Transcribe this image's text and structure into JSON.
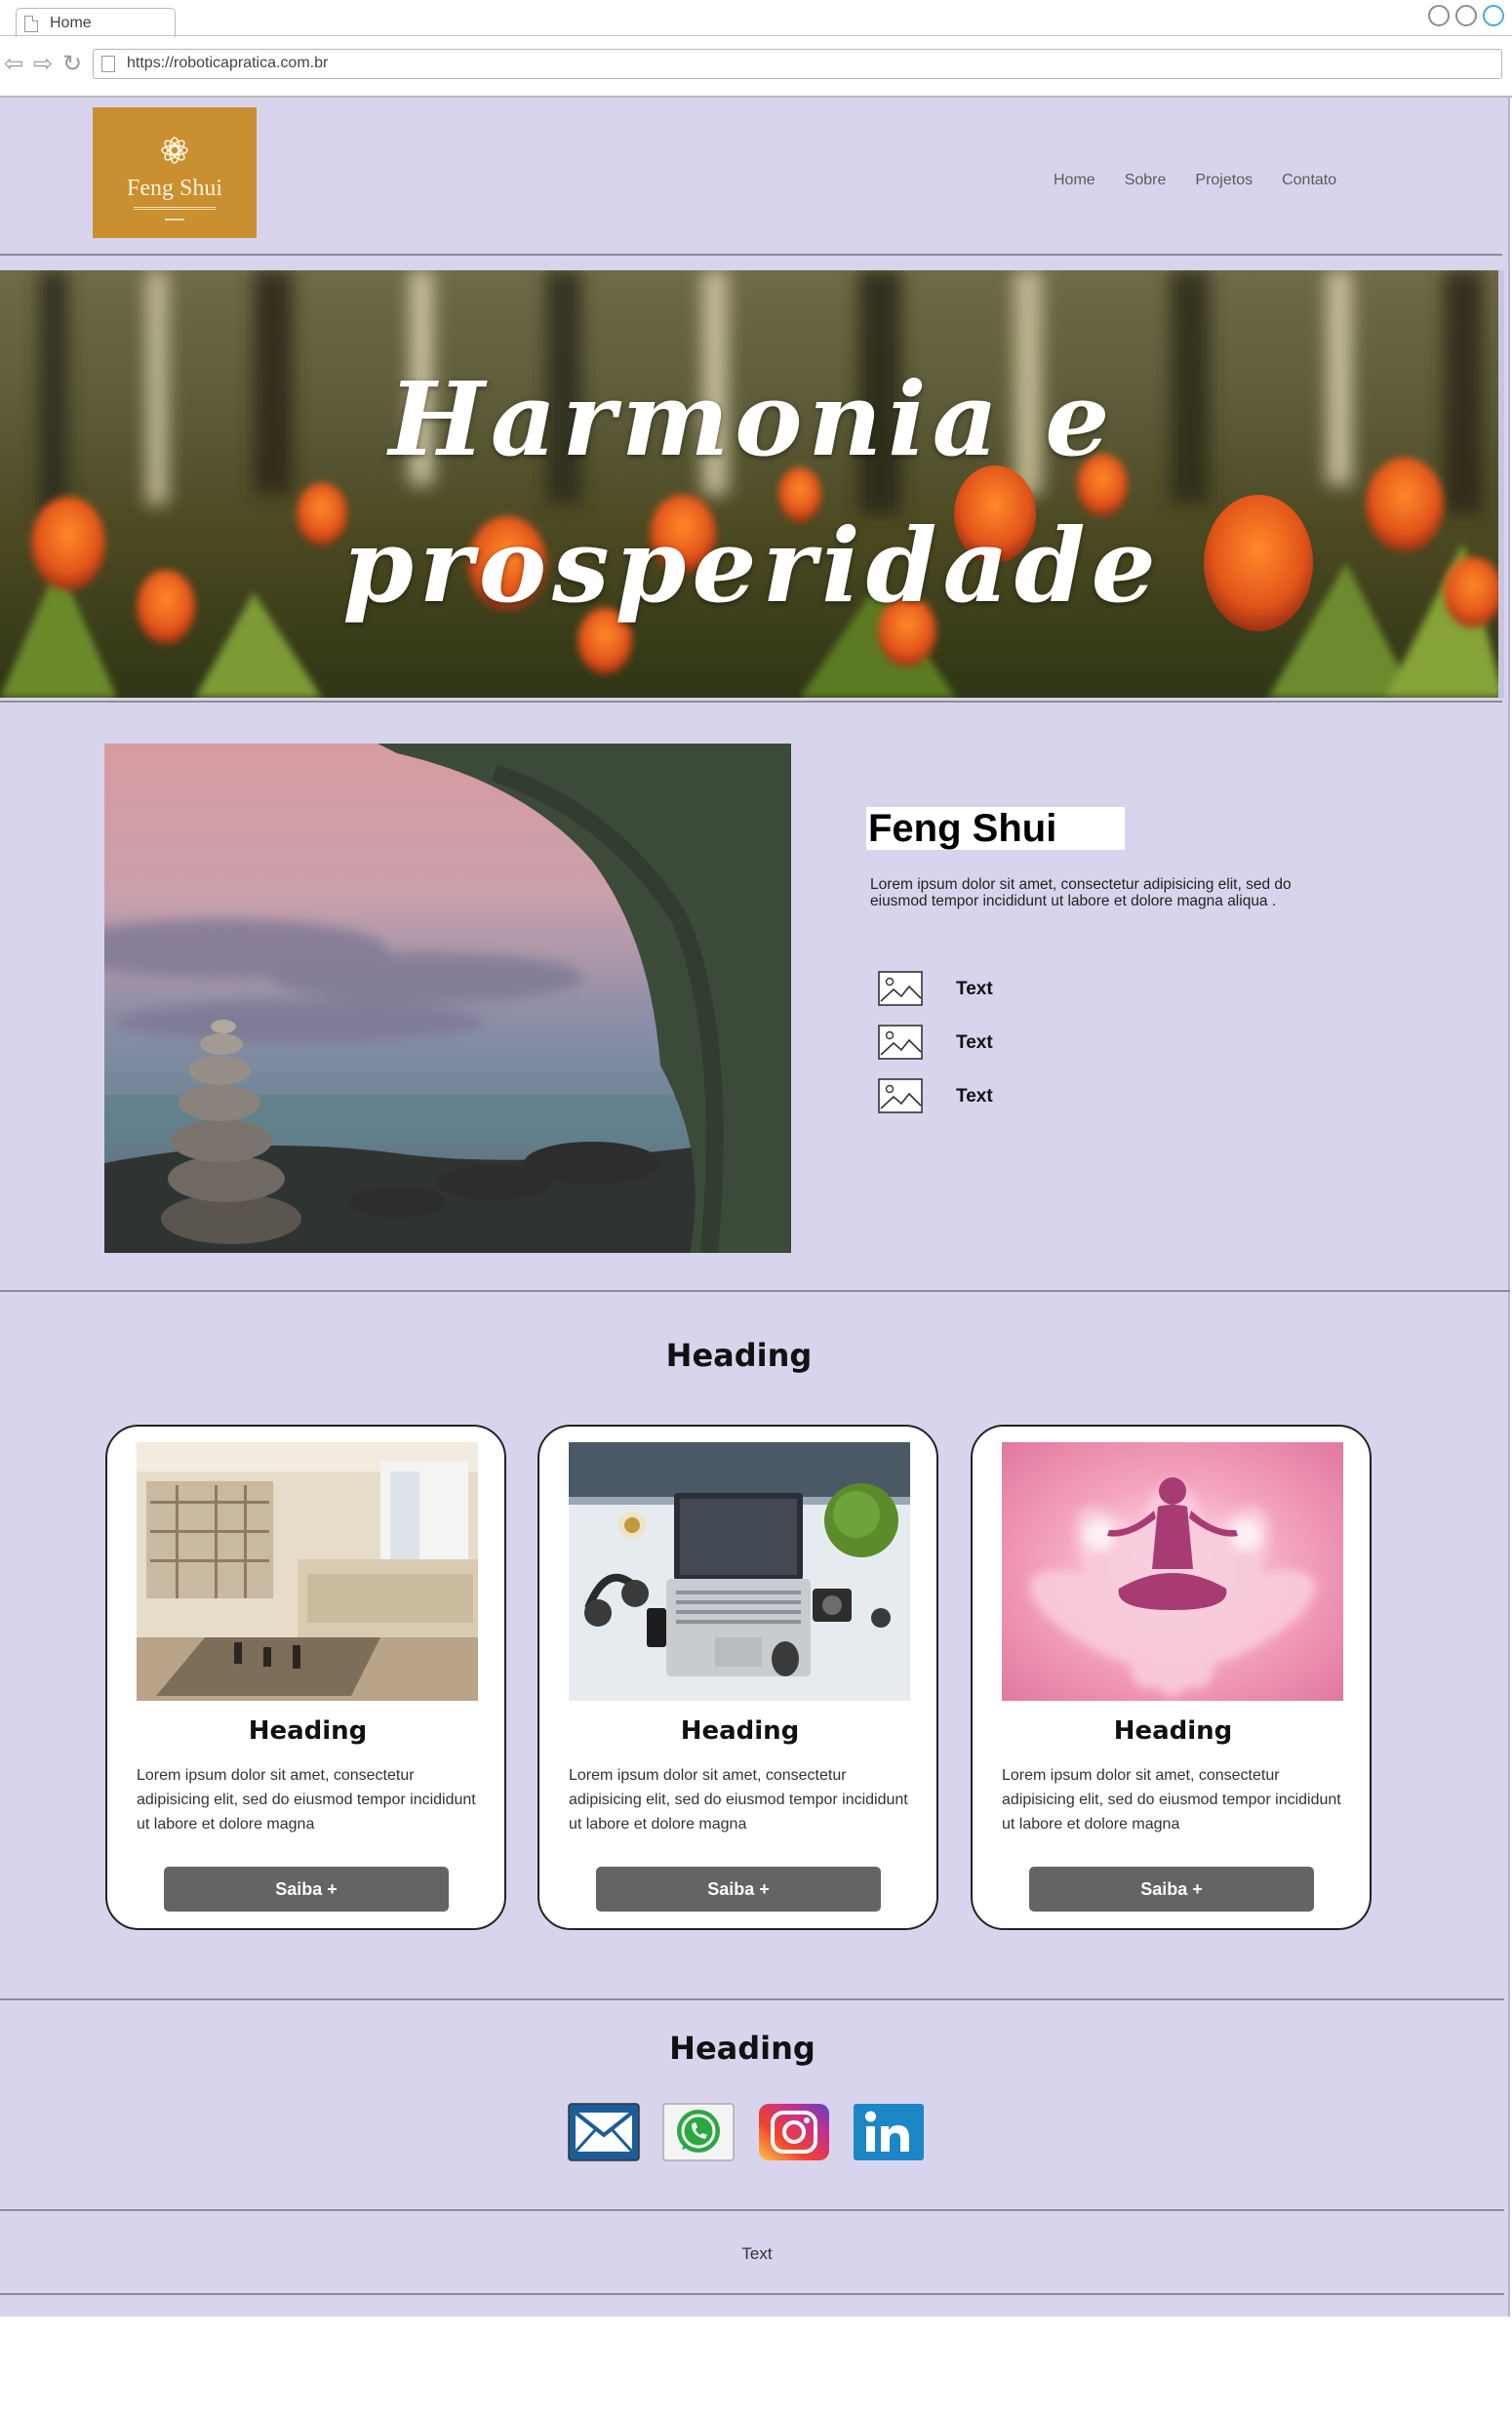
{
  "browser": {
    "tab_title": "Home",
    "url": "https://roboticapratica.com.br"
  },
  "header": {
    "logo_text": "Feng Shui",
    "nav": [
      "Home",
      "Sobre",
      "Projetos",
      "Contato"
    ]
  },
  "hero": {
    "title_line1": "Harmonia e",
    "title_line2": "prosperidade"
  },
  "about": {
    "title": "Feng Shui",
    "text": "Lorem ipsum dolor sit amet, consectetur adipisicing elit, sed do eiusmod tempor incididunt ut labore et dolore magna aliqua .",
    "features": [
      "Text",
      "Text",
      "Text"
    ]
  },
  "services": {
    "heading": "Heading",
    "cards": [
      {
        "heading": "Heading",
        "text": "Lorem ipsum dolor sit amet, consectetur adipisicing elit, sed do eiusmod tempor incididunt ut labore et dolore magna",
        "button": "Saiba +"
      },
      {
        "heading": "Heading",
        "text": "Lorem ipsum dolor sit amet, consectetur adipisicing elit, sed do eiusmod tempor incididunt ut labore et dolore magna",
        "button": "Saiba +"
      },
      {
        "heading": "Heading",
        "text": "Lorem ipsum dolor sit amet, consectetur adipisicing elit, sed do eiusmod tempor incididunt ut labore et dolore magna",
        "button": "Saiba +"
      }
    ]
  },
  "contact": {
    "heading": "Heading",
    "icons": [
      "email-icon",
      "whatsapp-icon",
      "instagram-icon",
      "linkedin-icon"
    ]
  },
  "footer": {
    "text": "Text"
  },
  "colors": {
    "page_background": "#d9d4ee",
    "logo_background": "#c98f30",
    "button": "#646464"
  }
}
